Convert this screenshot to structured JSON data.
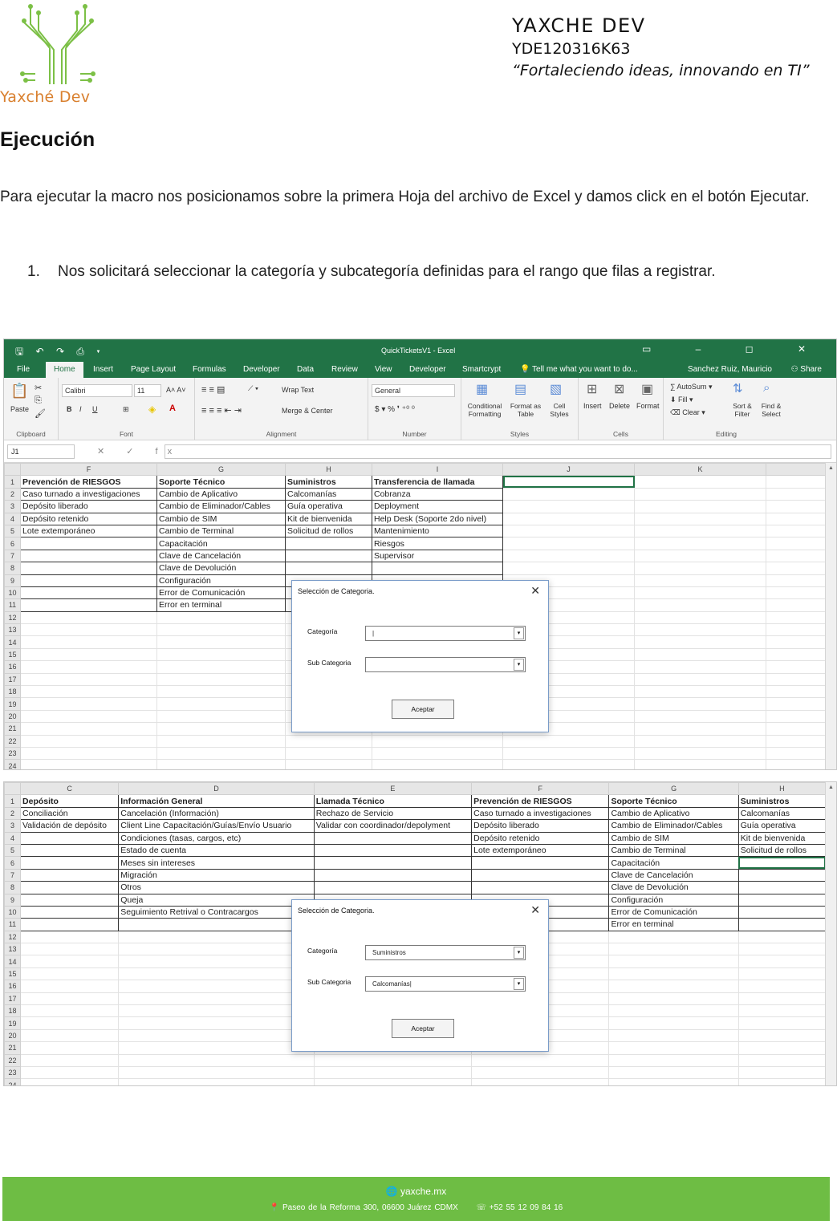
{
  "header": {
    "logo_text": "Yaxché Dev",
    "company_name": "YAXCHE DEV",
    "company_id": "YDE120316K63",
    "slogan": "“Fortaleciendo ideas, innovando en TI”"
  },
  "section_title": "Ejecución",
  "paragraph": "Para ejecutar la macro nos posicionamos sobre la primera Hoja del archivo de Excel y damos click en el botón Ejecutar.",
  "steps": [
    {
      "num": "1.",
      "text": "Nos solicitará seleccionar la categoría y subcategoría definidas para el rango que filas a registrar."
    }
  ],
  "colors": {
    "excel_green": "#217346",
    "footer_green": "#6ebd44",
    "logo_green": "#7cc046",
    "logo_orange": "#d9802f"
  },
  "excel": {
    "window_title": "QuickTicketsV1 - Excel",
    "quick_access": "🖫 ↶ ↷ ⎙ ▾",
    "window_controls": "▭ – ◻ ✕",
    "tabs": [
      "File",
      "Home",
      "Insert",
      "Page Layout",
      "Formulas",
      "Developer",
      "Data",
      "Review",
      "View",
      "Developer",
      "Smartcrypt"
    ],
    "tell_me": "💡 Tell me what you want to do...",
    "user": "Sanchez Ruiz, Mauricio",
    "share": "⚇ Share",
    "ribbon": {
      "clipboard": "Clipboard",
      "paste": "Paste",
      "font_group": "Font",
      "font_name": "Calibri",
      "font_size": "11",
      "alignment": "Alignment",
      "wrap_text": "Wrap Text",
      "merge_center": "Merge & Center",
      "number": "Number",
      "number_format": "General",
      "styles": "Styles",
      "cond_format": "Conditional Formatting",
      "format_table": "Format as Table",
      "cell_styles": "Cell Styles",
      "cells": "Cells",
      "insert": "Insert",
      "delete": "Delete",
      "format": "Format",
      "editing": "Editing",
      "autosum": "AutoSum",
      "fill": "Fill",
      "clear": "Clear",
      "sort_filter": "Sort & Filter",
      "find_select": "Find & Select"
    },
    "name_box": "J1",
    "fx": "✕ ✓ fx"
  },
  "sheet1": {
    "columns": [
      "F",
      "G",
      "H",
      "I",
      "J",
      "K"
    ],
    "rows": [
      [
        "Prevención de RIESGOS",
        "Soporte Técnico",
        "Suministros",
        "Transferencia de llamada",
        "",
        ""
      ],
      [
        "Caso turnado a investigaciones",
        "Cambio de Aplicativo",
        "Calcomanías",
        "Cobranza",
        "",
        ""
      ],
      [
        "Depósito liberado",
        "Cambio de Eliminador/Cables",
        "Guía operativa",
        "Deployment",
        "",
        ""
      ],
      [
        "Depósito retenido",
        "Cambio de SIM",
        "Kit de bienvenida",
        "Help Desk (Soporte 2do nivel)",
        "",
        ""
      ],
      [
        "Lote extemporáneo",
        "Cambio de Terminal",
        "Solicitud de rollos",
        "Mantenimiento",
        "",
        ""
      ],
      [
        "",
        "Capacitación",
        "",
        "Riesgos",
        "",
        ""
      ],
      [
        "",
        "Clave de Cancelación",
        "",
        "Supervisor",
        "",
        ""
      ],
      [
        "",
        "Clave de Devolución",
        "",
        "",
        "",
        ""
      ],
      [
        "",
        "Configuración",
        "",
        "",
        "",
        ""
      ],
      [
        "",
        "Error de Comunicación",
        "",
        "",
        "",
        ""
      ],
      [
        "",
        "Error en terminal",
        "",
        "",
        "",
        ""
      ]
    ],
    "total_rows": 24
  },
  "sheet2": {
    "columns": [
      "C",
      "D",
      "E",
      "F",
      "G",
      "H"
    ],
    "rows": [
      [
        "Depósito",
        "Información General",
        "Llamada Técnico",
        "Prevención de RIESGOS",
        "Soporte Técnico",
        "Suministros"
      ],
      [
        "Conciliación",
        "Cancelación (Información)",
        "Rechazo de Servicio",
        "Caso turnado a investigaciones",
        "Cambio de Aplicativo",
        "Calcomanías"
      ],
      [
        "Validación de depósito",
        "Client Line Capacitación/Guías/Envío Usuario",
        "Validar con coordinador/depolyment",
        "Depósito liberado",
        "Cambio de Eliminador/Cables",
        "Guía operativa"
      ],
      [
        "",
        "Condiciones (tasas, cargos, etc)",
        "",
        "Depósito retenido",
        "Cambio de SIM",
        "Kit de bienvenida"
      ],
      [
        "",
        "Estado de cuenta",
        "",
        "Lote extemporáneo",
        "Cambio de Terminal",
        "Solicitud de rollos"
      ],
      [
        "",
        "Meses sin intereses",
        "",
        "",
        "Capacitación",
        ""
      ],
      [
        "",
        "Migración",
        "",
        "",
        "Clave de Cancelación",
        ""
      ],
      [
        "",
        "Otros",
        "",
        "",
        "Clave de Devolución",
        ""
      ],
      [
        "",
        "Queja",
        "",
        "",
        "Configuración",
        ""
      ],
      [
        "",
        "Seguimiento Retrival o Contracargos",
        "",
        "",
        "Error de Comunicación",
        ""
      ],
      [
        "",
        "",
        "",
        "",
        "Error en terminal",
        ""
      ]
    ],
    "total_rows": 24
  },
  "dialog1": {
    "title": "Selección de Categoria.",
    "close": "✕",
    "category_label": "Categoría",
    "category_value": "|",
    "subcategory_label": "Sub Categoria",
    "subcategory_value": "",
    "dropdown": "▾",
    "accept": "Aceptar"
  },
  "dialog2": {
    "title": "Selección de Categoria.",
    "close": "✕",
    "category_label": "Categoría",
    "category_value": "Suministros",
    "subcategory_label": "Sub Categoria",
    "subcategory_value": "Calcomanías|",
    "dropdown": "▾",
    "accept": "Aceptar"
  },
  "footer": {
    "website": "🌐 yaxche.mx",
    "address": "📍 Paseo de la Reforma 300, 06600 Juárez CDMX",
    "phone": "☏ +52 55 12 09 84 16"
  }
}
